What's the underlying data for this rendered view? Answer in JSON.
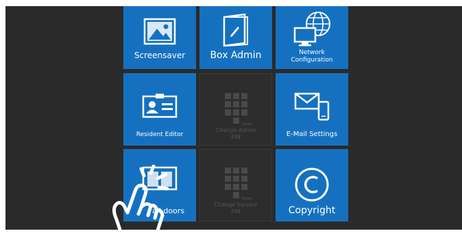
{
  "tiles": {
    "screensaver": {
      "label": "Screensaver",
      "icon": "image-icon"
    },
    "box_admin": {
      "label": "Box Admin",
      "icon": "folder-pen-icon"
    },
    "network": {
      "label_line1": "Network",
      "label_line2": "Configuration",
      "icon": "network-globe-icon"
    },
    "resident_editor": {
      "label": "Resident Editor",
      "icon": "id-card-icon"
    },
    "change_admin_pin": {
      "label_line1": "Change Admin",
      "label_line2": "PIN",
      "key_label": "Save",
      "icon": "keypad-icon"
    },
    "email_settings": {
      "label": "E-Mail Settings",
      "icon": "email-phone-icon"
    },
    "all_doors": {
      "label": "all doors",
      "icon": "doors-icon"
    },
    "change_service_pin": {
      "label_line1": "Change Service",
      "label_line2": "PIN",
      "key_label": "Save",
      "icon": "keypad-icon"
    },
    "copyright": {
      "label": "Copyright",
      "icon": "copyright-icon"
    }
  },
  "overlay": {
    "icon": "tap-hand-icon"
  },
  "colors": {
    "tile": "#1571bf",
    "background": "#2a2a2a",
    "disabled": "#2d2d2d"
  }
}
